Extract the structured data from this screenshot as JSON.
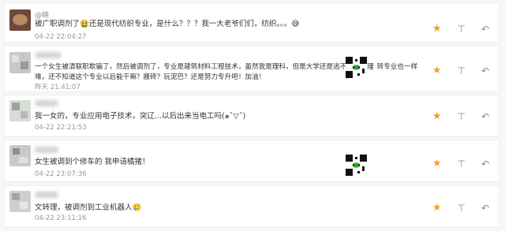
{
  "comments": [
    {
      "name": "@晓",
      "lines": [
        "被广职调剂了🤮还是现代纺织专业，是什么？？？我一大老爷们们，纺织。。。😅"
      ],
      "time": "04-22 22:04:27"
    },
    {
      "name": "",
      "lines": [
        "一个女生被清联职欺骗了，然后被调剂了，专业是建筑材料工程技术，虽然我是理科，但是大学还是逃不掉学物理",
        "难，还不知道这个专业以后能干嘛？搬砖？玩泥巴？还是努力专升吧！加油！"
      ],
      "extra": "，转专业也一样",
      "time": "昨天 21:41:07"
    },
    {
      "name": "",
      "lines": [
        "我一女的，专业应用电子技术，突辽...以后出来当电工吗(๑ˇ▽ˇ)"
      ],
      "time": "04-22 22:21:53"
    },
    {
      "name": "",
      "lines": [
        "女生被调到个修车的 我申请橘猪！"
      ],
      "time": "04-22 23:07:36"
    },
    {
      "name": "",
      "lines": [
        "文转理，被调剂到工业机器人🥲"
      ],
      "time": "04-22 23:11:16"
    }
  ],
  "icons": {
    "like": "star-icon",
    "dislike": "thumbs-down-icon",
    "reply": "reply-icon"
  },
  "accent": "#f0a020"
}
